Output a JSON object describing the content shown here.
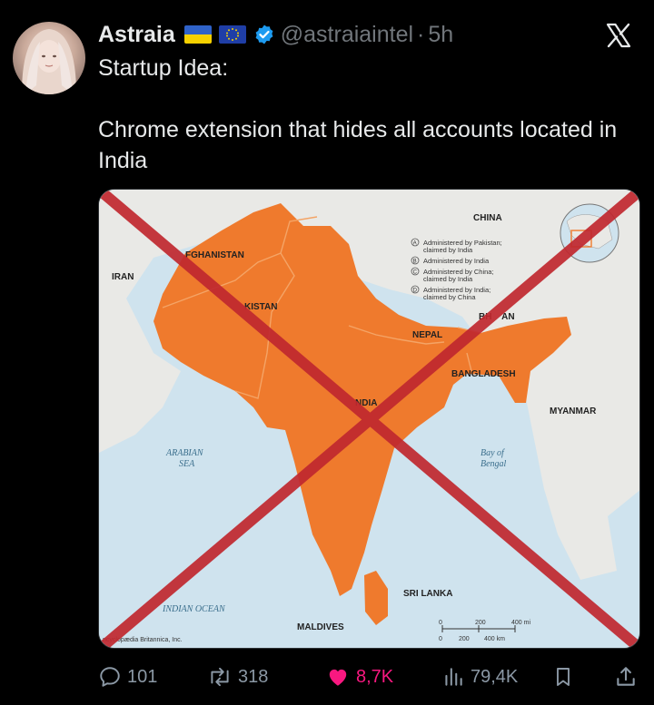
{
  "tweet": {
    "author_name": "Astraia",
    "handle": "@astraiaintel",
    "separator": "·",
    "time": "5h",
    "line1": "Startup Idea:",
    "line2": "Chrome extension that hides all accounts located in India",
    "avatar_icon": "avatar-photo",
    "flags": [
      "flag-ukraine-icon",
      "flag-eu-icon"
    ]
  },
  "map": {
    "labels": {
      "china": "CHINA",
      "iran": "IRAN",
      "afghanistan": "FGHANISTAN",
      "pakistan": "KISTAN",
      "nepal": "NEPAL",
      "bhutan": "BH    AN",
      "bangladesh": "BANGLADESH",
      "india": "NDIA",
      "myanmar": "MYANMAR",
      "arabian_sea_1": "ARABIAN",
      "arabian_sea_2": "SEA",
      "bay_1": "Bay of",
      "bay_2": "Bengal",
      "indian_ocean": "INDIAN OCEAN",
      "sri_lanka": "SRI LANKA",
      "maldives": "MALDIVES",
      "credit": "ncyclopædia Britannica, Inc."
    },
    "legend": [
      {
        "mark": "A",
        "lines": [
          "Administered by Pakistan;",
          "claimed by India"
        ]
      },
      {
        "mark": "B",
        "lines": [
          "Administered by India"
        ]
      },
      {
        "mark": "C",
        "lines": [
          "Administered by China;",
          "claimed by India"
        ]
      },
      {
        "mark": "D",
        "lines": [
          "Administered by India;",
          "claimed by China"
        ]
      }
    ],
    "scale": {
      "top": [
        "0",
        "200",
        "400 mi"
      ],
      "bottom": [
        "0",
        "200",
        "400 km"
      ]
    },
    "colors": {
      "land_highlight": "#ef7a2d",
      "land": "#e9e9e6",
      "sea": "#cfe3ee",
      "cross": "#c0282f"
    }
  },
  "actions": {
    "replies": "101",
    "reposts": "318",
    "likes": "8,7K",
    "views": "79,4K",
    "colors": {
      "muted": "#8b98a5",
      "like": "#f91880"
    }
  }
}
